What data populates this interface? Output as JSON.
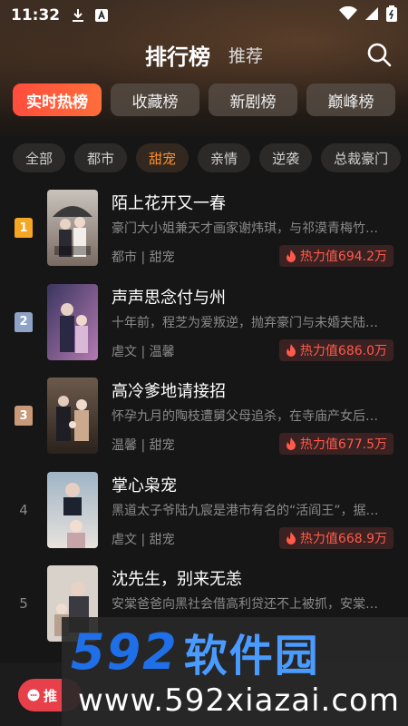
{
  "status_bar": {
    "time": "11:32"
  },
  "header": {
    "title": "排行榜",
    "subtitle": "推荐"
  },
  "main_tabs": [
    {
      "label": "实时热榜",
      "active": true
    },
    {
      "label": "收藏榜",
      "active": false
    },
    {
      "label": "新剧榜",
      "active": false
    },
    {
      "label": "巅峰榜",
      "active": false
    }
  ],
  "filters": [
    {
      "label": "全部",
      "active": false
    },
    {
      "label": "都市",
      "active": false
    },
    {
      "label": "甜宠",
      "active": true
    },
    {
      "label": "亲情",
      "active": false
    },
    {
      "label": "逆袭",
      "active": false
    },
    {
      "label": "总裁豪门",
      "active": false
    }
  ],
  "items": [
    {
      "rank": "1",
      "title": "陌上花开又一春",
      "desc": "豪门大小姐兼天才画家谢炜琪，与祁漠青梅竹…",
      "tags": "都市 | 甜宠",
      "heat": "热力值694.2万"
    },
    {
      "rank": "2",
      "title": "声声思念付与州",
      "desc": "十年前，程芝为爱叛逆，抛弃豪门与未婚夫陆…",
      "tags": "虐文 | 温馨",
      "heat": "热力值686.0万"
    },
    {
      "rank": "3",
      "title": "高冷爹地请接招",
      "desc": "怀孕九月的陶枝遭舅父母追杀，在寺庙产女后…",
      "tags": "温馨 | 甜宠",
      "heat": "热力值677.5万"
    },
    {
      "rank": "4",
      "title": "掌心枭宠",
      "desc": "黑道太子爷陆九宸是港市有名的“活阎王”，据…",
      "tags": "虐文 | 甜宠",
      "heat": "热力值668.9万"
    },
    {
      "rank": "5",
      "title": "沈先生，别来无恙",
      "desc": "安棠爸爸向黑社会借高利贷还不上被抓，安棠…",
      "tags": "",
      "heat": ""
    }
  ],
  "float_button": {
    "label": "推"
  },
  "watermark": {
    "big_digits": "592",
    "big_chars": "软件园",
    "url": "www.592xiazai.com"
  },
  "colors": {
    "accent": "#ff4d3d",
    "filter_active": "#ff8f2a",
    "heat": "#ff5a4a",
    "rank1": "#f5a623",
    "rank2": "#8fa3c7",
    "rank3": "#c89a7a"
  }
}
